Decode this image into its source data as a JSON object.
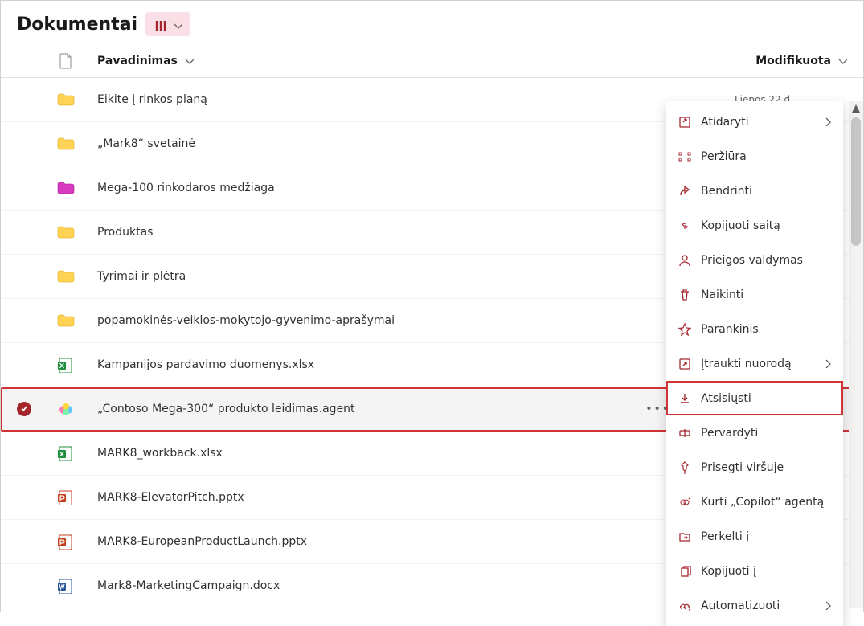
{
  "header": {
    "title": "Dokumentai"
  },
  "columns": {
    "name": "Pavadinimas",
    "modified": "Modifikuota"
  },
  "items": [
    {
      "icon": "folder-yellow",
      "name": "Eikite į rinkos planą",
      "date": "Liepos 22 d."
    },
    {
      "icon": "folder-yellow",
      "name": "„Mark8“ svetainė",
      "date": ""
    },
    {
      "icon": "folder-pink",
      "name": "Mega-100 rinkodaros medžiaga",
      "date": ""
    },
    {
      "icon": "folder-yellow",
      "name": "Produktas",
      "date": ""
    },
    {
      "icon": "folder-yellow",
      "name": "Tyrimai ir plėtra",
      "date": ""
    },
    {
      "icon": "folder-yellow",
      "name": "popamokinės-veiklos-mokytojo-gyvenimo-aprašymai",
      "date": ""
    },
    {
      "icon": "excel",
      "name": "Kampanijos pardavimo duomenys.xlsx",
      "date": ""
    },
    {
      "icon": "copilot",
      "name": "„Contoso Mega-300“ produkto leidimas.agent",
      "date": "",
      "selected": true,
      "more": true,
      "highlight": true
    },
    {
      "icon": "excel",
      "name": "MARK8_workback.xlsx",
      "date": ""
    },
    {
      "icon": "ppt",
      "name": "MARK8-ElevatorPitch.pptx",
      "date": ""
    },
    {
      "icon": "ppt",
      "name": "MARK8-EuropeanProductLaunch.pptx",
      "date": ""
    },
    {
      "icon": "word",
      "name": "Mark8-MarketingCampaign.docx",
      "date": ""
    }
  ],
  "context_menu": [
    {
      "icon": "open",
      "label": "Atidaryti",
      "submenu": true
    },
    {
      "icon": "preview",
      "label": "Peržiūra"
    },
    {
      "icon": "share",
      "label": "Bendrinti"
    },
    {
      "icon": "link",
      "label": "Kopijuoti saitą"
    },
    {
      "icon": "access",
      "label": "Prieigos valdymas"
    },
    {
      "icon": "delete",
      "label": "Naikinti"
    },
    {
      "icon": "star",
      "label": "Parankinis"
    },
    {
      "icon": "shortcut",
      "label": "Įtraukti nuorodą",
      "submenu": true
    },
    {
      "icon": "download",
      "label": "Atsisiųsti",
      "highlight": true
    },
    {
      "icon": "rename",
      "label": "Pervardyti"
    },
    {
      "icon": "pin",
      "label": "Prisegti viršuje"
    },
    {
      "icon": "copilotmk",
      "label": "Kurti „Copilot“ agentą"
    },
    {
      "icon": "move",
      "label": "Perkelti į"
    },
    {
      "icon": "copy",
      "label": "Kopijuoti į"
    },
    {
      "icon": "automate",
      "label": "Automatizuoti",
      "submenu": true
    }
  ]
}
